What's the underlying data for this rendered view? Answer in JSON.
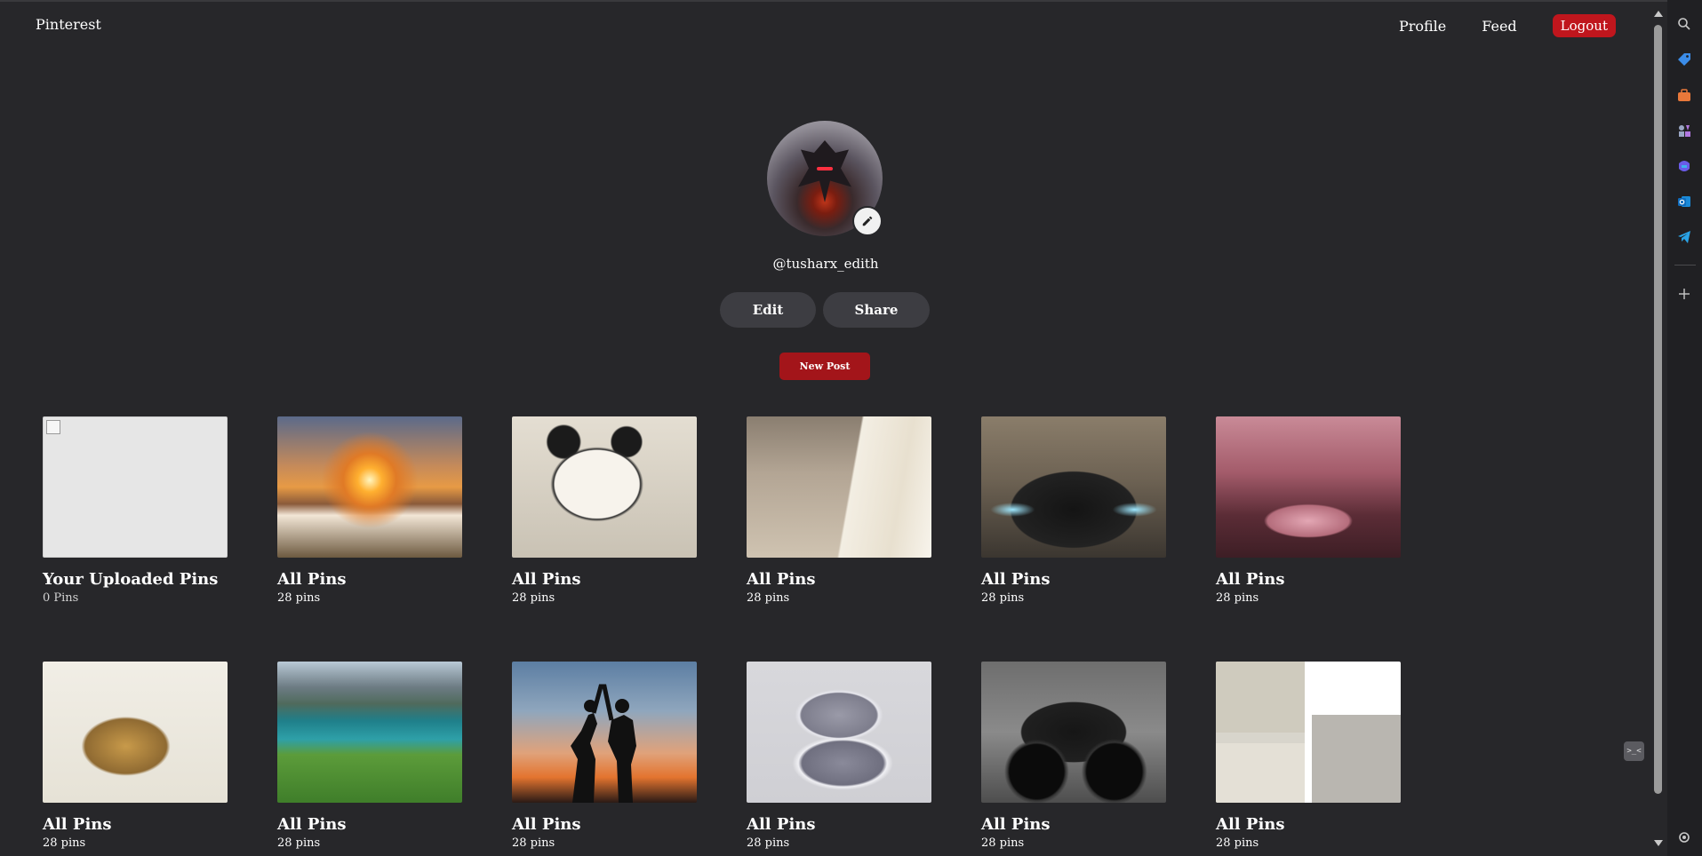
{
  "nav": {
    "brand": "Pinterest",
    "links": {
      "profile": "Profile",
      "feed": "Feed",
      "logout": "Logout"
    }
  },
  "profile": {
    "username": "@tusharx_edith",
    "edit_label": "Edit",
    "share_label": "Share",
    "new_post_label": "New Post"
  },
  "boards": [
    {
      "title": "Your Uploaded Pins",
      "count": "0 Pins",
      "image": "broken-image"
    },
    {
      "title": "All Pins",
      "count": "28 pins",
      "image": "sunset-flowers"
    },
    {
      "title": "All Pins",
      "count": "28 pins",
      "image": "panda-sketch"
    },
    {
      "title": "All Pins",
      "count": "28 pins",
      "image": "holding-hands-bangles"
    },
    {
      "title": "All Pins",
      "count": "28 pins",
      "image": "black-car"
    },
    {
      "title": "All Pins",
      "count": "28 pins",
      "image": "pink-car-blossoms"
    },
    {
      "title": "All Pins",
      "count": "28 pins",
      "image": "bangles-hand"
    },
    {
      "title": "All Pins",
      "count": "28 pins",
      "image": "lake-village"
    },
    {
      "title": "All Pins",
      "count": "28 pins",
      "image": "dancing-silhouette"
    },
    {
      "title": "All Pins",
      "count": "28 pins",
      "image": "sneakers"
    },
    {
      "title": "All Pins",
      "count": "28 pins",
      "image": "black-motorcycle"
    },
    {
      "title": "All Pins",
      "count": "28 pins",
      "image": "sleep-collage"
    }
  ],
  "sidebar": {
    "icons": [
      "search-icon",
      "tag-icon",
      "briefcase-icon",
      "chess-icon",
      "copilot-icon",
      "outlook-icon",
      "telegram-icon",
      "add-icon",
      "settings-icon"
    ]
  },
  "colors": {
    "background": "#27272a",
    "accent_red": "#c0161d",
    "new_post_red": "#a3151a",
    "pill_gray": "#3d3d42"
  }
}
